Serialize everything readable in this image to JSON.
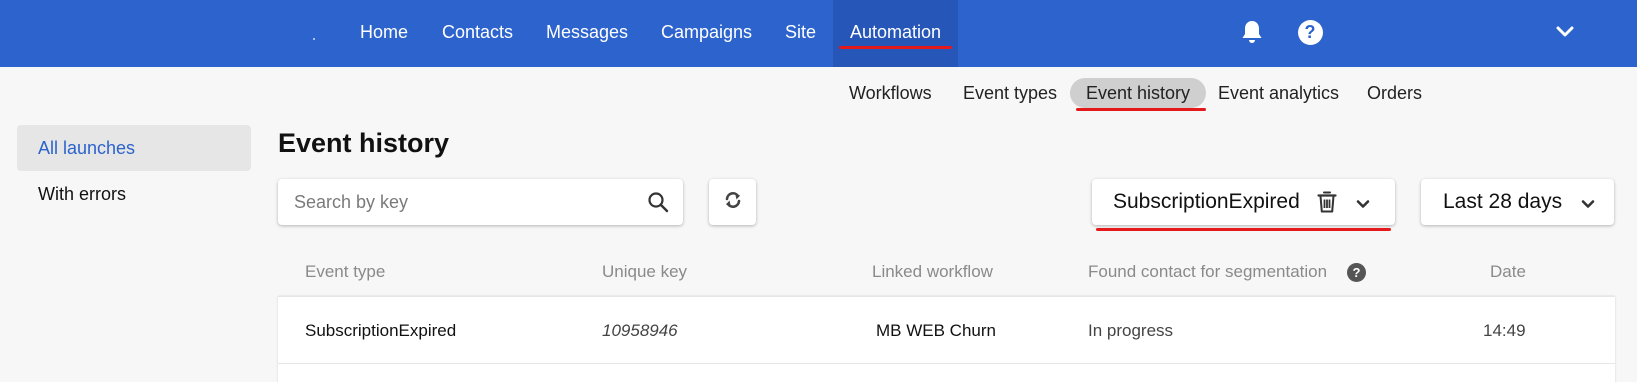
{
  "colors": {
    "brand": "#2c63cc",
    "accent_underline": "#e3191c",
    "active_link": "#2c63cc"
  },
  "topnav": {
    "items": [
      {
        "label": "Home"
      },
      {
        "label": "Contacts"
      },
      {
        "label": "Messages"
      },
      {
        "label": "Campaigns"
      },
      {
        "label": "Site"
      },
      {
        "label": "Automation",
        "active": true
      }
    ],
    "icons": [
      "bell-icon",
      "help-icon",
      "chevron-down-icon"
    ],
    "help_glyph": "?"
  },
  "subnav": {
    "items": [
      {
        "label": "Workflows"
      },
      {
        "label": "Event types"
      },
      {
        "label": "Event history",
        "active": true
      },
      {
        "label": "Event analytics"
      },
      {
        "label": "Orders"
      }
    ]
  },
  "sidebar": {
    "items": [
      {
        "label": "All launches",
        "active": true
      },
      {
        "label": "With errors"
      }
    ]
  },
  "page": {
    "title": "Event history"
  },
  "search": {
    "placeholder": "Search by key",
    "value": ""
  },
  "filters": {
    "event_type": {
      "value": "SubscriptionExpired"
    },
    "period": {
      "value": "Last 28 days"
    }
  },
  "table": {
    "columns": [
      "Event type",
      "Unique key",
      "Linked workflow",
      "Found contact for segmentation",
      "Date"
    ],
    "info_glyph": "?",
    "rows": [
      [
        "SubscriptionExpired",
        "10958946",
        "MB WEB Churn",
        "In progress",
        "14:49"
      ]
    ]
  }
}
